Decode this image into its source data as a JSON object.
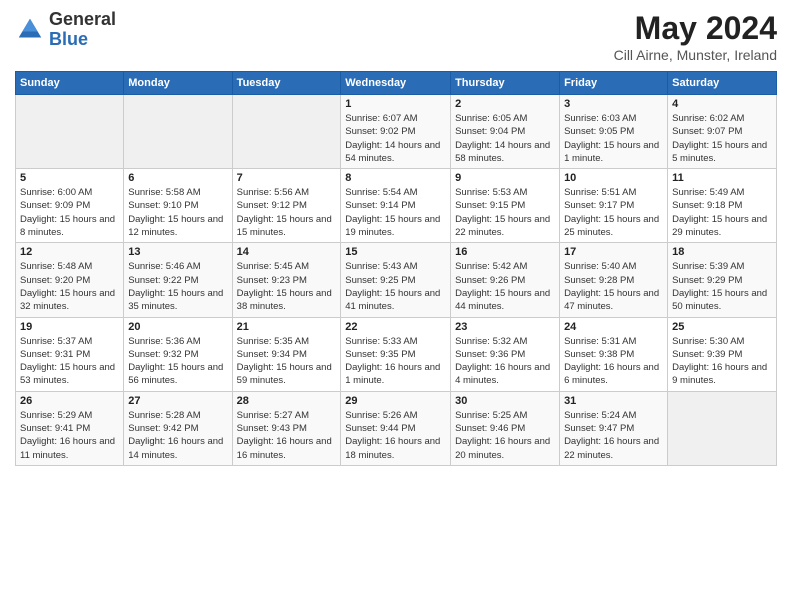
{
  "header": {
    "logo_general": "General",
    "logo_blue": "Blue",
    "title": "May 2024",
    "location": "Cill Airne, Munster, Ireland"
  },
  "weekdays": [
    "Sunday",
    "Monday",
    "Tuesday",
    "Wednesday",
    "Thursday",
    "Friday",
    "Saturday"
  ],
  "weeks": [
    [
      {
        "day": "",
        "sunrise": "",
        "sunset": "",
        "daylight": "",
        "empty": true
      },
      {
        "day": "",
        "sunrise": "",
        "sunset": "",
        "daylight": "",
        "empty": true
      },
      {
        "day": "",
        "sunrise": "",
        "sunset": "",
        "daylight": "",
        "empty": true
      },
      {
        "day": "1",
        "sunrise": "Sunrise: 6:07 AM",
        "sunset": "Sunset: 9:02 PM",
        "daylight": "Daylight: 14 hours and 54 minutes."
      },
      {
        "day": "2",
        "sunrise": "Sunrise: 6:05 AM",
        "sunset": "Sunset: 9:04 PM",
        "daylight": "Daylight: 14 hours and 58 minutes."
      },
      {
        "day": "3",
        "sunrise": "Sunrise: 6:03 AM",
        "sunset": "Sunset: 9:05 PM",
        "daylight": "Daylight: 15 hours and 1 minute."
      },
      {
        "day": "4",
        "sunrise": "Sunrise: 6:02 AM",
        "sunset": "Sunset: 9:07 PM",
        "daylight": "Daylight: 15 hours and 5 minutes."
      }
    ],
    [
      {
        "day": "5",
        "sunrise": "Sunrise: 6:00 AM",
        "sunset": "Sunset: 9:09 PM",
        "daylight": "Daylight: 15 hours and 8 minutes."
      },
      {
        "day": "6",
        "sunrise": "Sunrise: 5:58 AM",
        "sunset": "Sunset: 9:10 PM",
        "daylight": "Daylight: 15 hours and 12 minutes."
      },
      {
        "day": "7",
        "sunrise": "Sunrise: 5:56 AM",
        "sunset": "Sunset: 9:12 PM",
        "daylight": "Daylight: 15 hours and 15 minutes."
      },
      {
        "day": "8",
        "sunrise": "Sunrise: 5:54 AM",
        "sunset": "Sunset: 9:14 PM",
        "daylight": "Daylight: 15 hours and 19 minutes."
      },
      {
        "day": "9",
        "sunrise": "Sunrise: 5:53 AM",
        "sunset": "Sunset: 9:15 PM",
        "daylight": "Daylight: 15 hours and 22 minutes."
      },
      {
        "day": "10",
        "sunrise": "Sunrise: 5:51 AM",
        "sunset": "Sunset: 9:17 PM",
        "daylight": "Daylight: 15 hours and 25 minutes."
      },
      {
        "day": "11",
        "sunrise": "Sunrise: 5:49 AM",
        "sunset": "Sunset: 9:18 PM",
        "daylight": "Daylight: 15 hours and 29 minutes."
      }
    ],
    [
      {
        "day": "12",
        "sunrise": "Sunrise: 5:48 AM",
        "sunset": "Sunset: 9:20 PM",
        "daylight": "Daylight: 15 hours and 32 minutes."
      },
      {
        "day": "13",
        "sunrise": "Sunrise: 5:46 AM",
        "sunset": "Sunset: 9:22 PM",
        "daylight": "Daylight: 15 hours and 35 minutes."
      },
      {
        "day": "14",
        "sunrise": "Sunrise: 5:45 AM",
        "sunset": "Sunset: 9:23 PM",
        "daylight": "Daylight: 15 hours and 38 minutes."
      },
      {
        "day": "15",
        "sunrise": "Sunrise: 5:43 AM",
        "sunset": "Sunset: 9:25 PM",
        "daylight": "Daylight: 15 hours and 41 minutes."
      },
      {
        "day": "16",
        "sunrise": "Sunrise: 5:42 AM",
        "sunset": "Sunset: 9:26 PM",
        "daylight": "Daylight: 15 hours and 44 minutes."
      },
      {
        "day": "17",
        "sunrise": "Sunrise: 5:40 AM",
        "sunset": "Sunset: 9:28 PM",
        "daylight": "Daylight: 15 hours and 47 minutes."
      },
      {
        "day": "18",
        "sunrise": "Sunrise: 5:39 AM",
        "sunset": "Sunset: 9:29 PM",
        "daylight": "Daylight: 15 hours and 50 minutes."
      }
    ],
    [
      {
        "day": "19",
        "sunrise": "Sunrise: 5:37 AM",
        "sunset": "Sunset: 9:31 PM",
        "daylight": "Daylight: 15 hours and 53 minutes."
      },
      {
        "day": "20",
        "sunrise": "Sunrise: 5:36 AM",
        "sunset": "Sunset: 9:32 PM",
        "daylight": "Daylight: 15 hours and 56 minutes."
      },
      {
        "day": "21",
        "sunrise": "Sunrise: 5:35 AM",
        "sunset": "Sunset: 9:34 PM",
        "daylight": "Daylight: 15 hours and 59 minutes."
      },
      {
        "day": "22",
        "sunrise": "Sunrise: 5:33 AM",
        "sunset": "Sunset: 9:35 PM",
        "daylight": "Daylight: 16 hours and 1 minute."
      },
      {
        "day": "23",
        "sunrise": "Sunrise: 5:32 AM",
        "sunset": "Sunset: 9:36 PM",
        "daylight": "Daylight: 16 hours and 4 minutes."
      },
      {
        "day": "24",
        "sunrise": "Sunrise: 5:31 AM",
        "sunset": "Sunset: 9:38 PM",
        "daylight": "Daylight: 16 hours and 6 minutes."
      },
      {
        "day": "25",
        "sunrise": "Sunrise: 5:30 AM",
        "sunset": "Sunset: 9:39 PM",
        "daylight": "Daylight: 16 hours and 9 minutes."
      }
    ],
    [
      {
        "day": "26",
        "sunrise": "Sunrise: 5:29 AM",
        "sunset": "Sunset: 9:41 PM",
        "daylight": "Daylight: 16 hours and 11 minutes."
      },
      {
        "day": "27",
        "sunrise": "Sunrise: 5:28 AM",
        "sunset": "Sunset: 9:42 PM",
        "daylight": "Daylight: 16 hours and 14 minutes."
      },
      {
        "day": "28",
        "sunrise": "Sunrise: 5:27 AM",
        "sunset": "Sunset: 9:43 PM",
        "daylight": "Daylight: 16 hours and 16 minutes."
      },
      {
        "day": "29",
        "sunrise": "Sunrise: 5:26 AM",
        "sunset": "Sunset: 9:44 PM",
        "daylight": "Daylight: 16 hours and 18 minutes."
      },
      {
        "day": "30",
        "sunrise": "Sunrise: 5:25 AM",
        "sunset": "Sunset: 9:46 PM",
        "daylight": "Daylight: 16 hours and 20 minutes."
      },
      {
        "day": "31",
        "sunrise": "Sunrise: 5:24 AM",
        "sunset": "Sunset: 9:47 PM",
        "daylight": "Daylight: 16 hours and 22 minutes."
      },
      {
        "day": "",
        "sunrise": "",
        "sunset": "",
        "daylight": "",
        "empty": true
      }
    ]
  ]
}
